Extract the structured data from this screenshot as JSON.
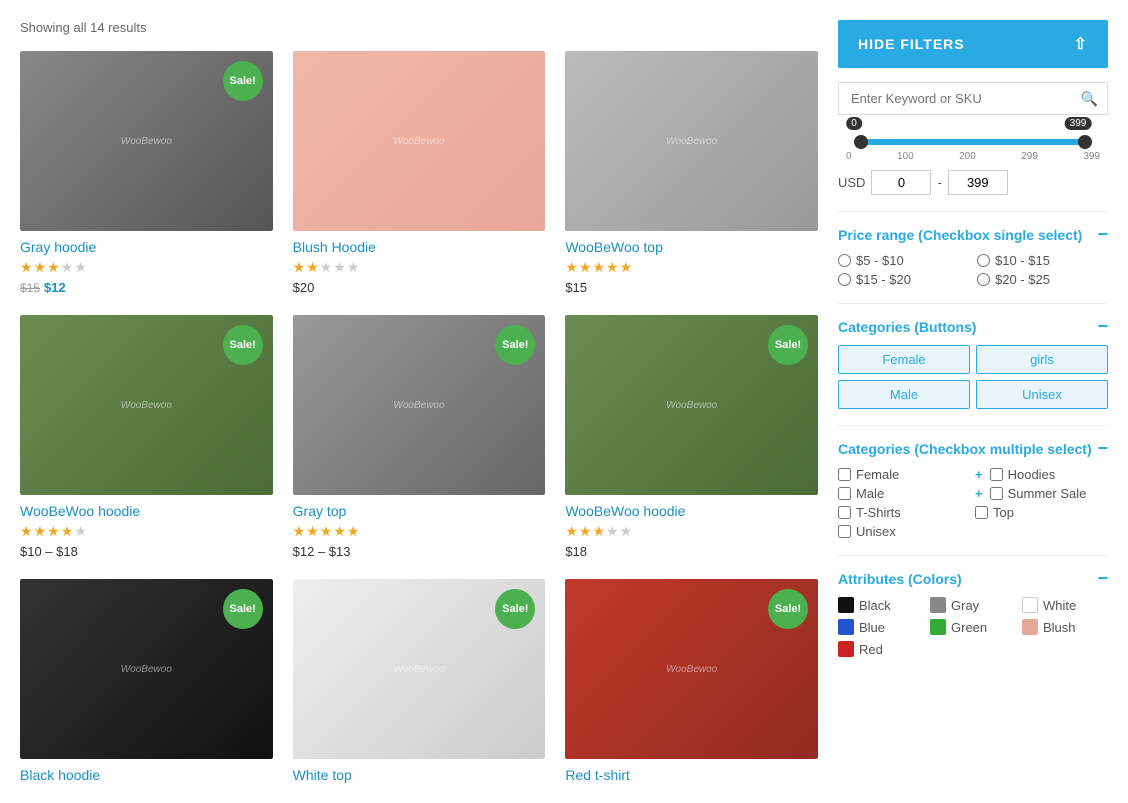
{
  "results_label": "Showing all 14 results",
  "products": [
    {
      "id": "gray-hoodie",
      "title": "Gray hoodie",
      "image_class": "img-gray-hoodie",
      "sale": true,
      "stars_filled": 3,
      "stars_empty": 2,
      "price_original": "$15",
      "price_current": "$12",
      "price_type": "sale"
    },
    {
      "id": "blush-hoodie",
      "title": "Blush Hoodie",
      "image_class": "img-blush-hoodie",
      "sale": false,
      "stars_filled": 2,
      "stars_empty": 3,
      "price_single": "$20",
      "price_type": "single"
    },
    {
      "id": "woobewoo-top",
      "title": "WooBeWoo top",
      "image_class": "img-woo-top",
      "sale": false,
      "stars_filled": 5,
      "stars_empty": 0,
      "price_single": "$15",
      "price_type": "single"
    },
    {
      "id": "woobewoo-hoodie-1",
      "title": "WooBeWoo hoodie",
      "image_class": "img-green-hoodie",
      "sale": true,
      "stars_filled": 4,
      "stars_empty": 1,
      "price_range_low": "$10",
      "price_range_high": "$18",
      "price_type": "range"
    },
    {
      "id": "gray-top",
      "title": "Gray top",
      "image_class": "img-gray-top",
      "sale": true,
      "stars_filled": 5,
      "stars_empty": 0,
      "price_range_low": "$12",
      "price_range_high": "$13",
      "price_type": "range"
    },
    {
      "id": "woobewoo-hoodie-2",
      "title": "WooBeWoo hoodie",
      "image_class": "img-green-hoodie2",
      "sale": true,
      "stars_filled": 3,
      "stars_empty": 2,
      "price_single": "$18",
      "price_type": "single"
    },
    {
      "id": "black-hoodie",
      "title": "Black hoodie",
      "image_class": "img-black-hoodie",
      "sale": true,
      "stars_filled": 0,
      "stars_empty": 0,
      "price_single": "",
      "price_type": "none"
    },
    {
      "id": "white-top",
      "title": "White top",
      "image_class": "img-white-top",
      "sale": true,
      "stars_filled": 0,
      "stars_empty": 0,
      "price_single": "",
      "price_type": "none"
    },
    {
      "id": "red-tshirt",
      "title": "Red t-shirt",
      "image_class": "img-red-tshirt",
      "sale": true,
      "stars_filled": 0,
      "stars_empty": 0,
      "price_single": "",
      "price_type": "none"
    }
  ],
  "sidebar": {
    "hide_filters_label": "HIDE FILTERS",
    "search_placeholder": "Enter Keyword or SKU",
    "price_slider": {
      "min": 0,
      "max": 399,
      "current_min": 0,
      "current_max": 399,
      "labels": [
        "0",
        "100",
        "200",
        "299",
        "399"
      ],
      "usd_label": "USD",
      "dash": "-"
    },
    "price_range_heading": "Price range (Checkbox single select)",
    "price_options": [
      {
        "label": "$5 - $10",
        "value": "5-10"
      },
      {
        "label": "$10 - $15",
        "value": "10-15"
      },
      {
        "label": "$15 - $20",
        "value": "15-20"
      },
      {
        "label": "$20 - $25",
        "value": "20-25"
      }
    ],
    "categories_buttons_heading": "Categories (Buttons)",
    "category_buttons": [
      "Female",
      "girls",
      "Male",
      "Unisex"
    ],
    "categories_checkbox_heading": "Categories (Checkbox multiple select)",
    "checkbox_left": [
      {
        "label": "Female"
      },
      {
        "label": "Male"
      },
      {
        "label": "T-Shirts"
      },
      {
        "label": "Unisex"
      }
    ],
    "checkbox_right": [
      {
        "label": "Hoodies",
        "plus": true
      },
      {
        "label": "Summer Sale",
        "plus": true
      },
      {
        "label": "Top"
      }
    ],
    "attributes_heading": "Attributes (Colors)",
    "colors": [
      {
        "name": "Black",
        "hex": "#111111"
      },
      {
        "name": "Gray",
        "hex": "#888888"
      },
      {
        "name": "White",
        "hex": "#ffffff"
      },
      {
        "name": "Blue",
        "hex": "#2255cc"
      },
      {
        "name": "Green",
        "hex": "#33aa33"
      },
      {
        "name": "Blush",
        "hex": "#e8a898"
      },
      {
        "name": "Red",
        "hex": "#cc2222"
      }
    ]
  }
}
